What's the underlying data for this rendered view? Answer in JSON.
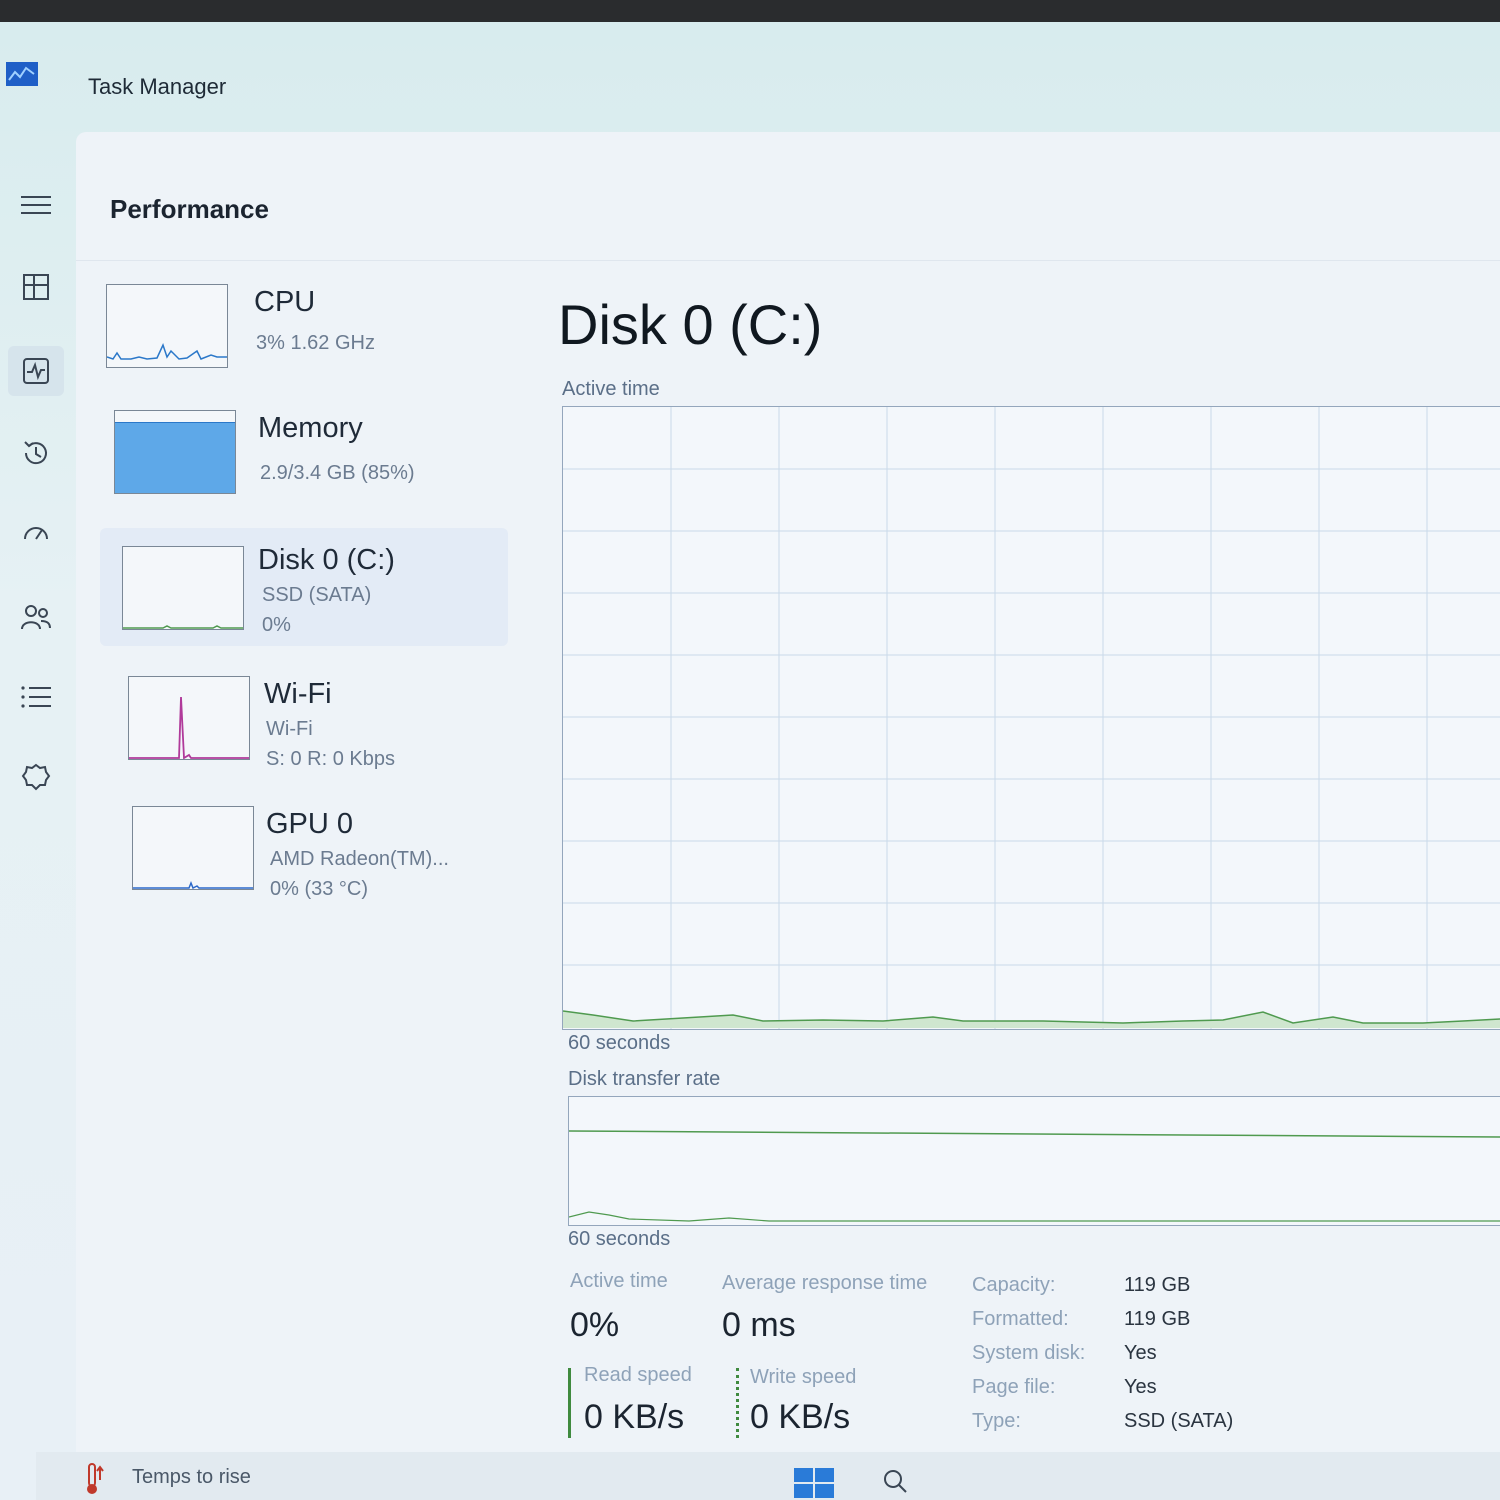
{
  "window": {
    "title": "Task Manager"
  },
  "nav": {
    "items": [
      {
        "icon": "hamburger-menu-icon"
      },
      {
        "icon": "processes-icon"
      },
      {
        "icon": "performance-icon",
        "selected": true
      },
      {
        "icon": "app-history-icon"
      },
      {
        "icon": "startup-apps-icon"
      },
      {
        "icon": "users-icon"
      },
      {
        "icon": "details-icon"
      },
      {
        "icon": "services-icon"
      }
    ],
    "settings_icon": "settings-icon"
  },
  "page": {
    "title": "Performance"
  },
  "sidebar": {
    "items": [
      {
        "name": "CPU",
        "sub1": "3% 1.62 GHz",
        "sub2": ""
      },
      {
        "name": "Memory",
        "sub1": "2.9/3.4 GB (85%)",
        "sub2": "",
        "fill_fraction": 0.85
      },
      {
        "name": "Disk 0 (C:)",
        "sub1": "SSD (SATA)",
        "sub2": "0%",
        "selected": true
      },
      {
        "name": "Wi-Fi",
        "sub1": "Wi-Fi",
        "sub2": "S: 0 R: 0 Kbps"
      },
      {
        "name": "GPU 0",
        "sub1": "AMD Radeon(TM)...",
        "sub2": "0% (33 °C)"
      }
    ]
  },
  "main": {
    "title": "Disk 0 (C:)",
    "active_time_label": "Active time",
    "active_time_span": "60 seconds",
    "transfer_rate_label": "Disk transfer rate",
    "transfer_rate_span": "60 seconds"
  },
  "stats": {
    "active_time": {
      "label": "Active time",
      "value": "0%"
    },
    "avg_response": {
      "label": "Average response time",
      "value": "0 ms"
    },
    "read_speed": {
      "label": "Read speed",
      "value": "0 KB/s"
    },
    "write_speed": {
      "label": "Write speed",
      "value": "0 KB/s"
    }
  },
  "properties": [
    {
      "key": "Capacity:",
      "value": "119 GB"
    },
    {
      "key": "Formatted:",
      "value": "119 GB"
    },
    {
      "key": "System disk:",
      "value": "Yes"
    },
    {
      "key": "Page file:",
      "value": "Yes"
    },
    {
      "key": "Type:",
      "value": "SSD (SATA)"
    }
  ],
  "taskbar": {
    "weather_text": "Temps to rise",
    "weather_icon": "thermometer-icon",
    "start_icon": "windows-start-icon",
    "search_icon": "search-icon"
  },
  "colors": {
    "disk_line": "#4f9a4f",
    "memory_fill": "#5ea8e8",
    "wifi_line": "#b03a9a",
    "cpu_line": "#2b78c9",
    "gpu_line": "#2b68c9"
  }
}
